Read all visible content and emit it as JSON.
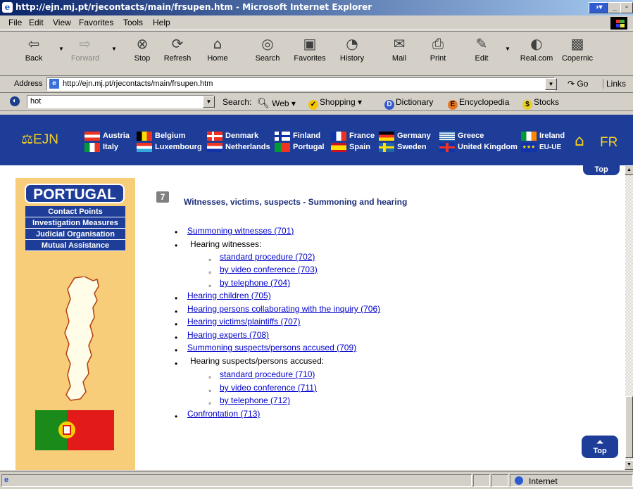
{
  "window": {
    "title": "http://ejn.mj.pt/rjecontacts/main/frsupen.htm - Microsoft Internet Explorer"
  },
  "menu": [
    "File",
    "Edit",
    "View",
    "Favorites",
    "Tools",
    "Help"
  ],
  "toolbar": {
    "back": "Back",
    "forward": "Forward",
    "stop": "Stop",
    "refresh": "Refresh",
    "home": "Home",
    "search": "Search",
    "favorites": "Favorites",
    "history": "History",
    "mail": "Mail",
    "print": "Print",
    "edit": "Edit",
    "realcom": "Real.com",
    "copernic": "Copernic"
  },
  "address": {
    "label": "Address",
    "url": "http://ejn.mj.pt/rjecontacts/main/frsupen.htm",
    "go": "Go",
    "links": "Links"
  },
  "searchbar": {
    "query": "hot",
    "search_label": "Search:",
    "web": "Web",
    "shopping": "Shopping",
    "dictionary": "Dictionary",
    "encyclopedia": "Encyclopedia",
    "stocks": "Stocks"
  },
  "ejn": {
    "logo": "EJN",
    "fr": "FR",
    "countries": {
      "austria": "Austria",
      "italy": "Italy",
      "belgium": "Belgium",
      "luxembourg": "Luxembourg",
      "denmark": "Denmark",
      "netherlands": "Netherlands",
      "finland": "Finland",
      "portugal": "Portugal",
      "france": "France",
      "spain": "Spain",
      "germany": "Germany",
      "sweden": "Sweden",
      "greece": "Greece",
      "uk": "United Kingdom",
      "ireland": "Ireland",
      "euue": "EU-UE"
    }
  },
  "sidebar": {
    "country": "PORTUGAL",
    "items": [
      "Contact Points",
      "Investigation Measures",
      "Judicial Organisation",
      "Mutual Assistance"
    ]
  },
  "main": {
    "top": "Top",
    "section_number": "7",
    "section_title": "Witnesses, victims, suspects - Summoning and hearing",
    "items": {
      "i701": "Summoning witnesses (701)",
      "hearing_witnesses": "Hearing witnesses:",
      "i702": "standard procedure (702)",
      "i703": "by video conference (703)",
      "i704": "by telephone (704)",
      "i705": "Hearing children (705)",
      "i706": "Hearing persons collaborating with the inquiry (706)",
      "i707": "Hearing victims/plaintiffs (707)",
      "i708": "Hearing experts (708)",
      "i709": "Summoning suspects/persons accused (709)",
      "hearing_suspects": "Hearing suspects/persons accused:",
      "i710": "standard procedure (710)",
      "i711": "by video conference (711)",
      "i712": "by telephone (712)",
      "i713": "Confrontation (713)"
    }
  },
  "status": {
    "zone": "Internet"
  }
}
